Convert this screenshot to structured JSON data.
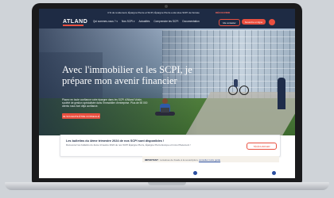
{
  "topbar": {
    "text": "4 % de rendement, Épargne Pierre et SCPI, Épargne Pierre a été élue SCPI de l'année",
    "link": "DÉCOUVRIR"
  },
  "navbar": {
    "logo": "ATLAND",
    "items": [
      "Qui sommes-nous ? ▾",
      "Nos SCPI ▾",
      "Actualités",
      "Comprendre les SCPI",
      "Documentation"
    ],
    "cta_secondary": "Me contacter",
    "cta_primary": "Souscrire en ligne"
  },
  "hero": {
    "title": "Avec l'immobilier et les SCPI, je prépare mon avenir financier",
    "description": "Placez en toute confiance votre épargne dans les SCPI d'Atland Voisin, société de gestion spécialisée dans l'immobilier d'entreprise. Plus de 55 000 clients nous font déjà confiance.",
    "button": "JE SOUHAITE ÊTRE CONSEILLÉ"
  },
  "info_card": {
    "title": "Les bulletins du 4ème trimestre 2024 de nos SCPI sont disponibles !",
    "text": "Découvrez les bulletins du 4ème trimestre 2024 de nos SCPI Épargne Pierre, Épargne Pierre Europe et Immo Placement !",
    "button": "TÉLÉCHARGER"
  },
  "notice": {
    "label": "IMPORTANT",
    "text": " : tentatives de fraude à la souscription,",
    "link": "consulter notre guide"
  }
}
